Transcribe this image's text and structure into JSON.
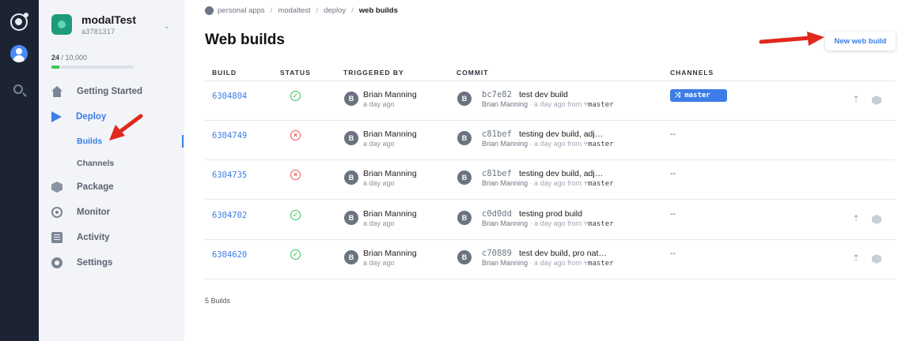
{
  "app": {
    "name": "modalTest",
    "id": "a3781317",
    "usage_current": "24",
    "usage_limit": "/ 10,000",
    "usage_fraction": 0.0024
  },
  "rail": {
    "icons": [
      "ionic-logo-icon",
      "user-avatar-icon",
      "search-icon"
    ]
  },
  "sidebar": {
    "items": [
      {
        "label": "Getting Started",
        "icon": "home-icon"
      },
      {
        "label": "Deploy",
        "icon": "deploy-icon"
      },
      {
        "label": "Builds"
      },
      {
        "label": "Channels"
      },
      {
        "label": "Package",
        "icon": "package-icon"
      },
      {
        "label": "Monitor",
        "icon": "monitor-icon"
      },
      {
        "label": "Activity",
        "icon": "activity-icon"
      },
      {
        "label": "Settings",
        "icon": "settings-icon"
      }
    ]
  },
  "breadcrumb": [
    "personal apps",
    "modaltest",
    "deploy",
    "web builds"
  ],
  "header": {
    "title": "Web builds",
    "new_build_label": "New web build"
  },
  "table": {
    "columns": [
      "BUILD",
      "STATUS",
      "TRIGGERED BY",
      "COMMIT",
      "CHANNELS"
    ],
    "rows": [
      {
        "build": "6304804",
        "status": "success",
        "avatar": "B",
        "user": "Brian Manning",
        "time": "a day ago",
        "sha": "bc7e82",
        "message": "test dev build",
        "commit_user": "Brian Manning",
        "commit_time": "· a day ago",
        "from": "from",
        "branch": "master",
        "channel": "master",
        "actions": true
      },
      {
        "build": "6304749",
        "status": "failed",
        "avatar": "B",
        "user": "Brian Manning",
        "time": "a day ago",
        "sha": "c81bef",
        "message": "testing dev build, adj…",
        "commit_user": "Brian Manning",
        "commit_time": "· a day ago",
        "from": "from",
        "branch": "master",
        "channel": "--",
        "actions": false
      },
      {
        "build": "6304735",
        "status": "failed",
        "avatar": "B",
        "user": "Brian Manning",
        "time": "a day ago",
        "sha": "c81bef",
        "message": "testing dev build, adj…",
        "commit_user": "Brian Manning",
        "commit_time": "· a day ago",
        "from": "from",
        "branch": "master",
        "channel": "--",
        "actions": false
      },
      {
        "build": "6304702",
        "status": "success",
        "avatar": "B",
        "user": "Brian Manning",
        "time": "a day ago",
        "sha": "c0d0dd",
        "message": "testing prod build",
        "commit_user": "Brian Manning",
        "commit_time": "· a day ago",
        "from": "from",
        "branch": "master",
        "channel": "--",
        "actions": true
      },
      {
        "build": "6304620",
        "status": "success",
        "avatar": "B",
        "user": "Brian Manning",
        "time": "a day ago",
        "sha": "c70889",
        "message": "test dev build, pro nat…",
        "commit_user": "Brian Manning",
        "commit_time": "· a day ago",
        "from": "from",
        "branch": "master",
        "channel": "--",
        "actions": true
      }
    ]
  },
  "footer": {
    "count": "5 Builds"
  },
  "colors": {
    "accent": "#3c7de8",
    "success": "#36c25a",
    "failure": "#e8545a",
    "annotation_arrow": "#e0281c",
    "rail": "#1c2434",
    "sidebar": "#f2f4f8"
  }
}
